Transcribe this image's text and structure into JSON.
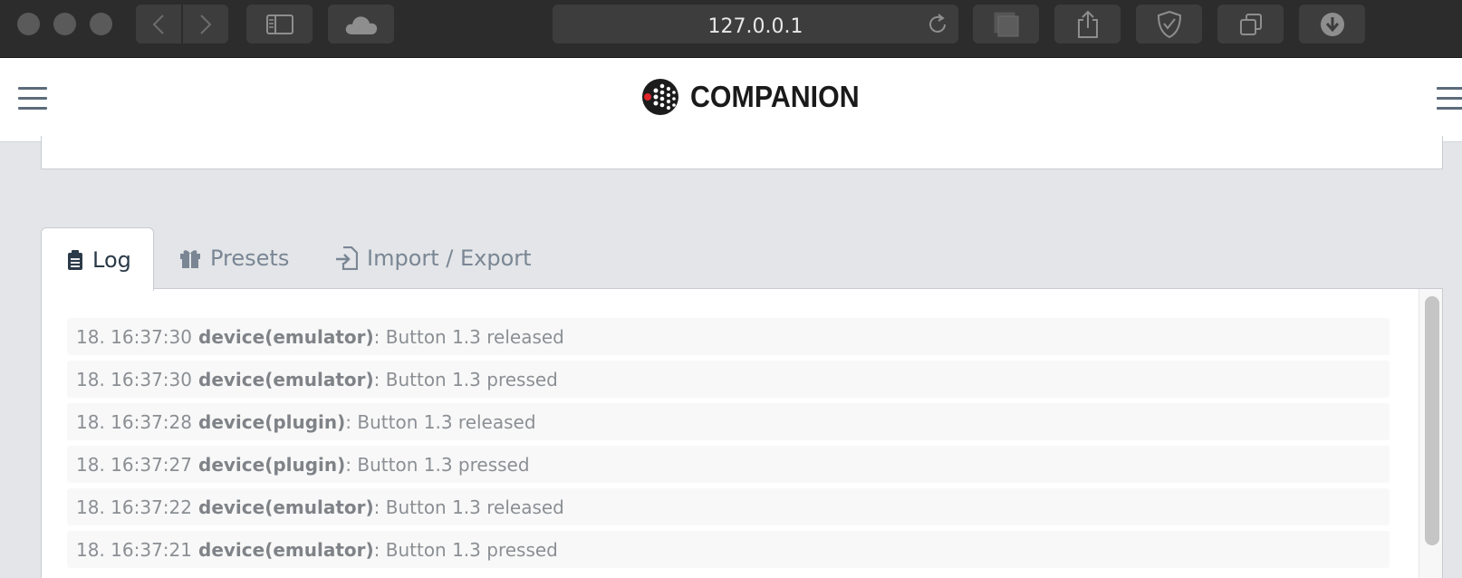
{
  "browser": {
    "address": "127.0.0.1",
    "icons": [
      "back-icon",
      "forward-icon",
      "sidebar-icon",
      "icloud-icon",
      "reload-icon",
      "reader-icon",
      "share-icon",
      "shield-icon",
      "tabs-icon",
      "download-icon"
    ]
  },
  "app": {
    "logo_text": "COMPANION"
  },
  "tabs": [
    {
      "label": "Log",
      "icon": "clipboard-icon",
      "active": true
    },
    {
      "label": "Presets",
      "icon": "gift-icon",
      "active": false
    },
    {
      "label": "Import / Export",
      "icon": "import-icon",
      "active": false
    }
  ],
  "log": [
    {
      "time": "18. 16:37:30",
      "source": "device(emulator)",
      "message": ": Button 1.3 released"
    },
    {
      "time": "18. 16:37:30",
      "source": "device(emulator)",
      "message": ": Button 1.3 pressed"
    },
    {
      "time": "18. 16:37:28",
      "source": "device(plugin)",
      "message": ": Button 1.3 released"
    },
    {
      "time": "18. 16:37:27",
      "source": "device(plugin)",
      "message": ": Button 1.3 pressed"
    },
    {
      "time": "18. 16:37:22",
      "source": "device(emulator)",
      "message": ": Button 1.3 released"
    },
    {
      "time": "18. 16:37:21",
      "source": "device(emulator)",
      "message": ": Button 1.3 pressed"
    }
  ],
  "colors": {
    "chrome": "#2c2c2c",
    "page_background": "#e3e5e8",
    "logo_accent": "#e1262d"
  }
}
